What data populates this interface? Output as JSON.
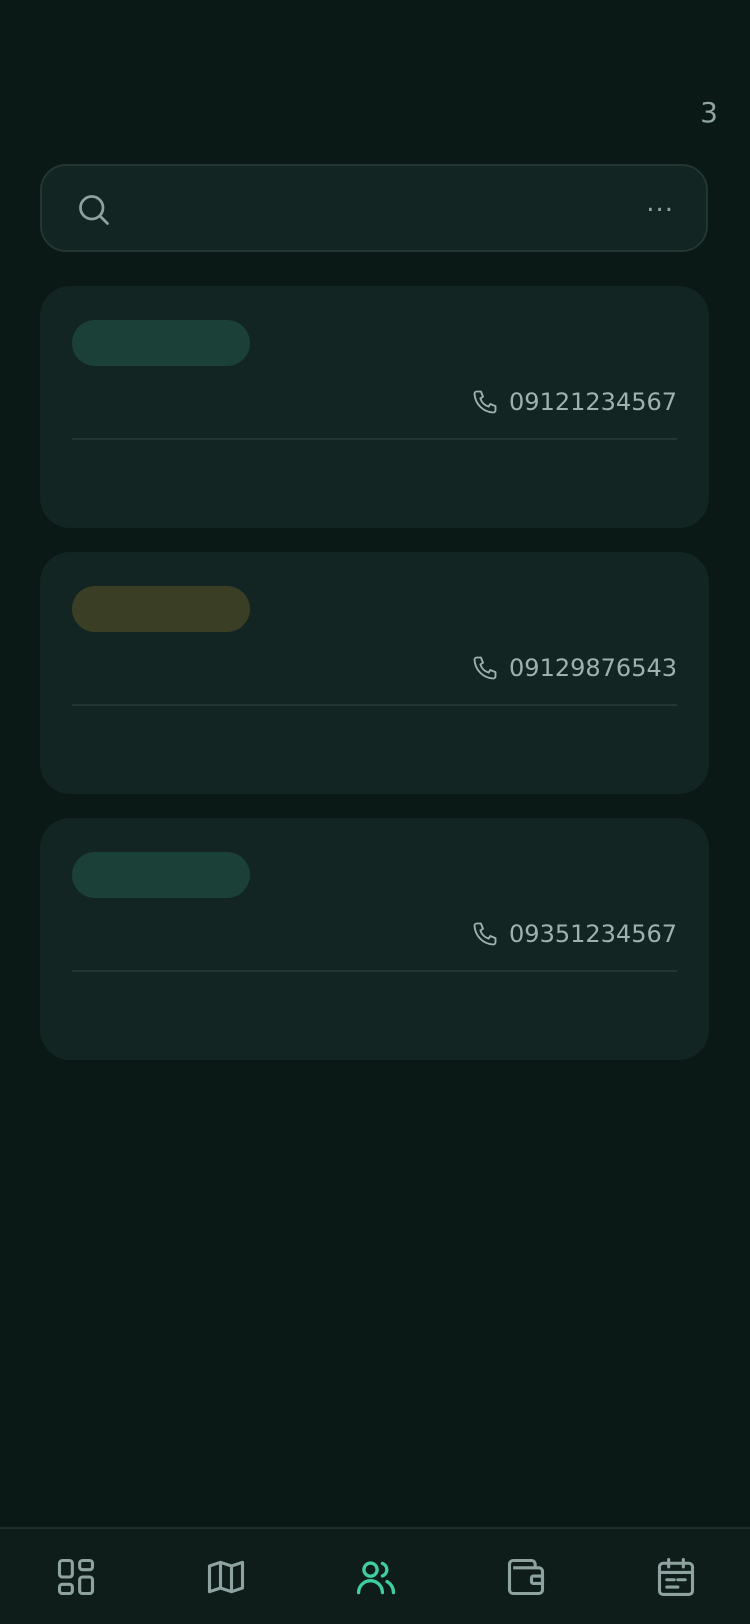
{
  "header": {
    "count": "3"
  },
  "search": {
    "placeholder": "...",
    "icon": "search-icon"
  },
  "contacts": [
    {
      "phone": "09121234567",
      "tag_color": "#1b4038"
    },
    {
      "phone": "09129876543",
      "tag_color": "#3a3e24"
    },
    {
      "phone": "09351234567",
      "tag_color": "#1b4038"
    }
  ],
  "colors": {
    "background": "#0a1816",
    "card": "#122523",
    "accent": "#3fcf9f",
    "icon": "#8ea39f",
    "divider": "#243633"
  },
  "bottom_nav": {
    "items": [
      {
        "icon": "dashboard-icon",
        "active": false
      },
      {
        "icon": "map-icon",
        "active": false
      },
      {
        "icon": "users-icon",
        "active": true
      },
      {
        "icon": "wallet-icon",
        "active": false
      },
      {
        "icon": "calendar-icon",
        "active": false
      }
    ]
  }
}
